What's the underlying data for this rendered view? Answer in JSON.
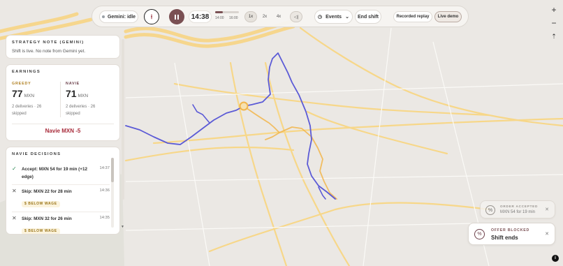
{
  "topbar": {
    "gemini_status": "Gemini: idle",
    "logo_glyph": "⍿",
    "clock": "14:38",
    "timeline_start": "14:00",
    "timeline_end": "16:00",
    "timeline_progress": 0.32,
    "speeds": [
      "1x",
      "2x",
      "4x"
    ],
    "active_speed": "1x",
    "collapse_label": "◁|",
    "events_label": "Events",
    "end_shift_label": "End shift",
    "recorded_replay_label": "Recorded replay",
    "live_demo_label": "Live demo"
  },
  "map_controls": {
    "zoom_in": "+",
    "zoom_out": "−",
    "reset": "⇡"
  },
  "strategy": {
    "title": "STRATEGY NOTE (GEMINI)",
    "message": "Shift is live. No note from Gemini yet."
  },
  "earnings": {
    "title": "EARNINGS",
    "greedy": {
      "label": "GREEDY",
      "value": "77",
      "currency": "MXN",
      "deliveries": "2 deliveries · 26",
      "skipped": "skipped"
    },
    "navie": {
      "label": "NAVIE",
      "value": "71",
      "currency": "MXN",
      "deliveries": "2 deliveries · 26",
      "skipped": "skipped"
    },
    "difference": "Navie MXN -5"
  },
  "decisions": {
    "title": "NAVIE DECISIONS",
    "items": [
      {
        "icon": "✓",
        "icon_name": "check-icon",
        "text": "Accept: MXN 54 for 19 min (+12 edge)",
        "time": "14:37",
        "badge": ""
      },
      {
        "icon": "✕",
        "icon_name": "x-icon",
        "text": "Skip: MXN 22 for 28 min",
        "time": "14:36",
        "badge": "$ BELOW WAGE"
      },
      {
        "icon": "✕",
        "icon_name": "x-icon",
        "text": "Skip: MXN 32 for 26 min",
        "time": "14:35",
        "badge": "$ BELOW WAGE"
      }
    ]
  },
  "toasts": {
    "accepted": {
      "title": "ORDER ACCEPTED",
      "message": "MXN 54 for 19 min",
      "close": "✕"
    },
    "blocked": {
      "title": "OFFER BLOCKED",
      "message": "Shift ends",
      "close": "✕"
    }
  },
  "colors": {
    "accent": "#7a5053",
    "navie_route": "#5b5ad6",
    "greedy_route": "#f2b54a",
    "road": "#f7d27a",
    "map_bg": "#ebe8e4",
    "alert_red": "#a82b3a"
  },
  "corner_icon": "i"
}
